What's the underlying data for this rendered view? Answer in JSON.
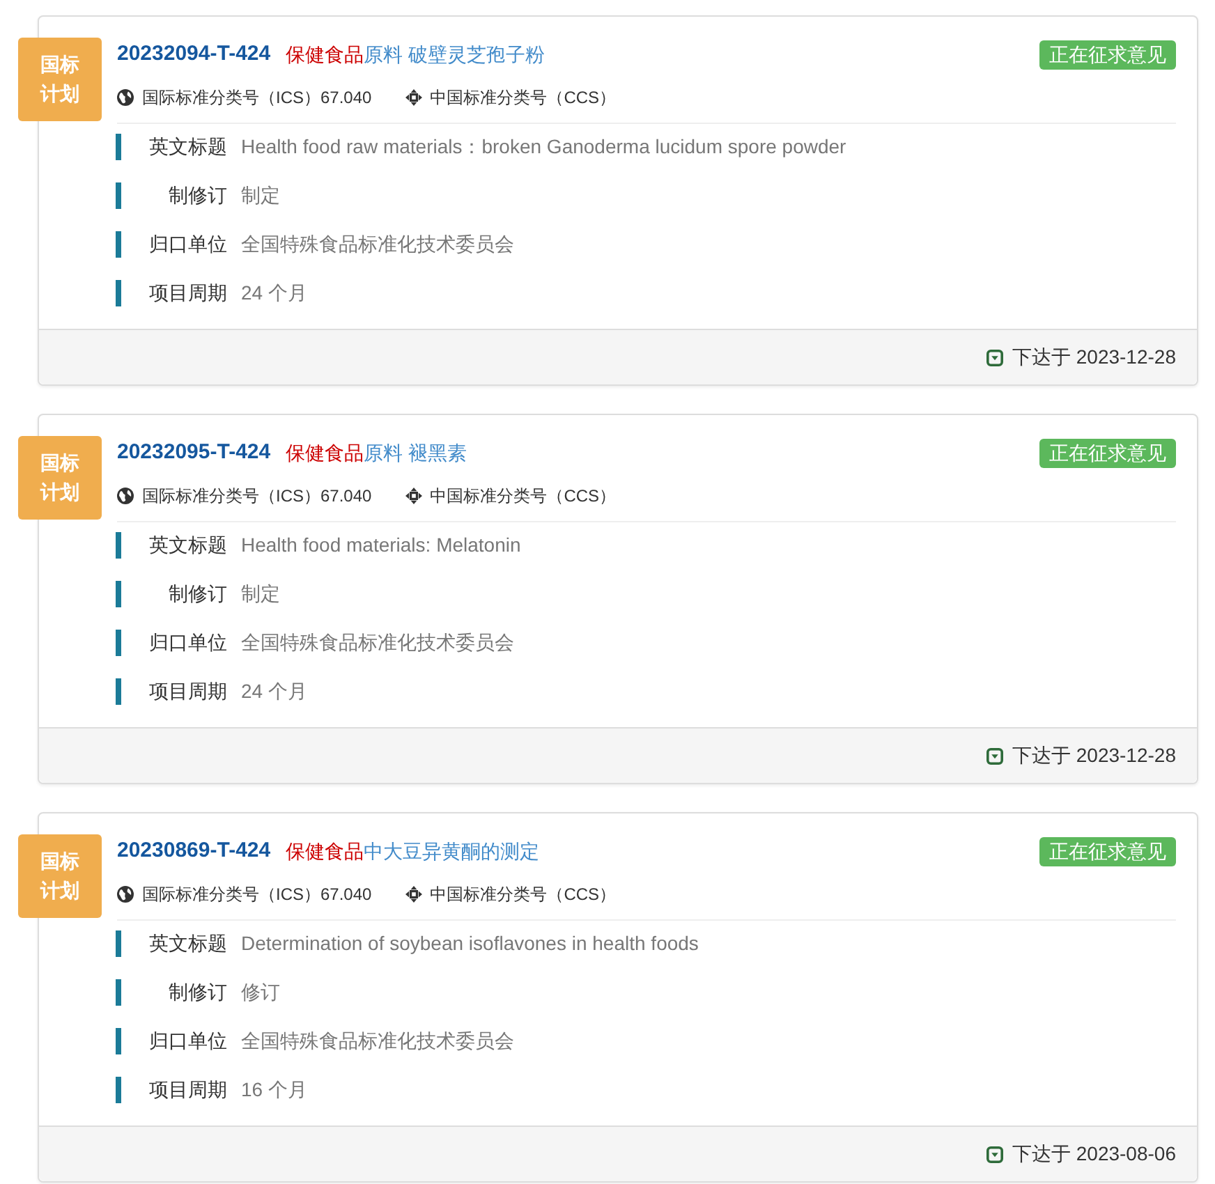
{
  "cards": [
    {
      "plan_badge": "国标计划",
      "code": "20232094-T-424",
      "title": {
        "highlight": "保健食品",
        "rest": "原料 破壁灵芝孢子粉"
      },
      "status": "正在征求意见",
      "ics": "国际标准分类号（ICS）67.040",
      "ccs": "中国标准分类号（CCS）",
      "fields": [
        {
          "label": "英文标题",
          "value": "Health food raw materials：broken Ganoderma lucidum spore powder"
        },
        {
          "label": "制修订",
          "value": "制定"
        },
        {
          "label": "归口单位",
          "value": "全国特殊食品标准化技术委员会"
        },
        {
          "label": "项目周期",
          "value": "24 个月"
        }
      ],
      "footer": "下达于 2023-12-28"
    },
    {
      "plan_badge": "国标计划",
      "code": "20232095-T-424",
      "title": {
        "highlight": "保健食品",
        "rest": "原料 褪黑素"
      },
      "status": "正在征求意见",
      "ics": "国际标准分类号（ICS）67.040",
      "ccs": "中国标准分类号（CCS）",
      "fields": [
        {
          "label": "英文标题",
          "value": "Health food materials: Melatonin"
        },
        {
          "label": "制修订",
          "value": "制定"
        },
        {
          "label": "归口单位",
          "value": "全国特殊食品标准化技术委员会"
        },
        {
          "label": "项目周期",
          "value": "24 个月"
        }
      ],
      "footer": "下达于 2023-12-28"
    },
    {
      "plan_badge": "国标计划",
      "code": "20230869-T-424",
      "title": {
        "highlight": "保健食品",
        "rest": "中大豆异黄酮的测定"
      },
      "status": "正在征求意见",
      "ics": "国际标准分类号（ICS）67.040",
      "ccs": "中国标准分类号（CCS）",
      "fields": [
        {
          "label": "英文标题",
          "value": "Determination of soybean isoflavones in health foods"
        },
        {
          "label": "制修订",
          "value": "修订"
        },
        {
          "label": "归口单位",
          "value": "全国特殊食品标准化技术委员会"
        },
        {
          "label": "项目周期",
          "value": "16 个月"
        }
      ],
      "footer": "下达于 2023-08-06"
    }
  ]
}
